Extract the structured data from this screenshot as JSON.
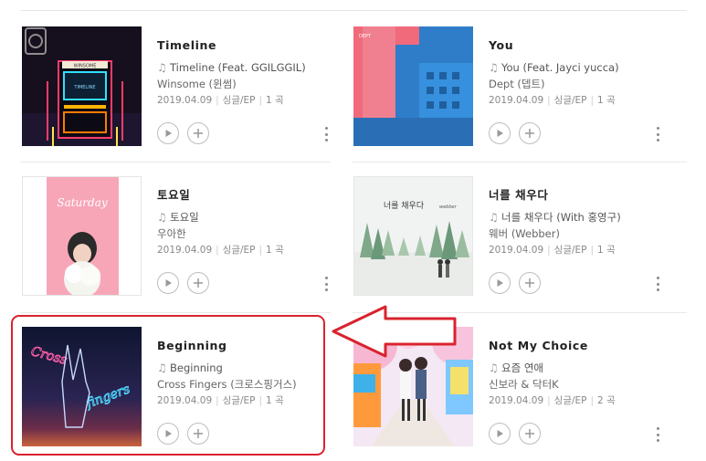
{
  "albums": [
    {
      "title": "Timeline",
      "track": "Timeline (Feat. GGILGGIL)",
      "artist": "Winsome (윈썸)",
      "date": "2019.04.09",
      "type": "싱글/EP",
      "count": "1 곡",
      "cover_text": "WINSOME",
      "cover_subtext": "TIMELINE"
    },
    {
      "title": "You",
      "track": "You (Feat. Jayci yucca)",
      "artist": "Dept (뎁트)",
      "date": "2019.04.09",
      "type": "싱글/EP",
      "count": "1 곡",
      "cover_text": "DEPT"
    },
    {
      "title": "토요일",
      "track": "토요일",
      "artist": "우아한",
      "date": "2019.04.09",
      "type": "싱글/EP",
      "count": "1 곡",
      "cover_text": "Saturday"
    },
    {
      "title": "너를 채우다",
      "track": "너를 채우다 (With 홍영구)",
      "artist": "웨버 (Webber)",
      "date": "2019.04.09",
      "type": "싱글/EP",
      "count": "1 곡",
      "cover_text": "너를 채우다",
      "cover_subtext": "webber"
    },
    {
      "title": "Beginning",
      "track": "Beginning",
      "artist": "Cross Fingers (크로스핑거스)",
      "date": "2019.04.09",
      "type": "싱글/EP",
      "count": "1 곡",
      "cover_text": "Cross",
      "cover_subtext": "fingers"
    },
    {
      "title": "Not My Choice",
      "track": "요즘 연애",
      "artist": "신보라 & 닥터K",
      "date": "2019.04.09",
      "type": "싱글/EP",
      "count": "2 곡"
    }
  ],
  "icons": {
    "track": "music-note-icon",
    "play": "play-icon",
    "add": "plus-icon",
    "more": "more-vertical-icon"
  },
  "colors": {
    "highlight": "#d9232e",
    "text": "#222222",
    "muted": "#888888"
  }
}
